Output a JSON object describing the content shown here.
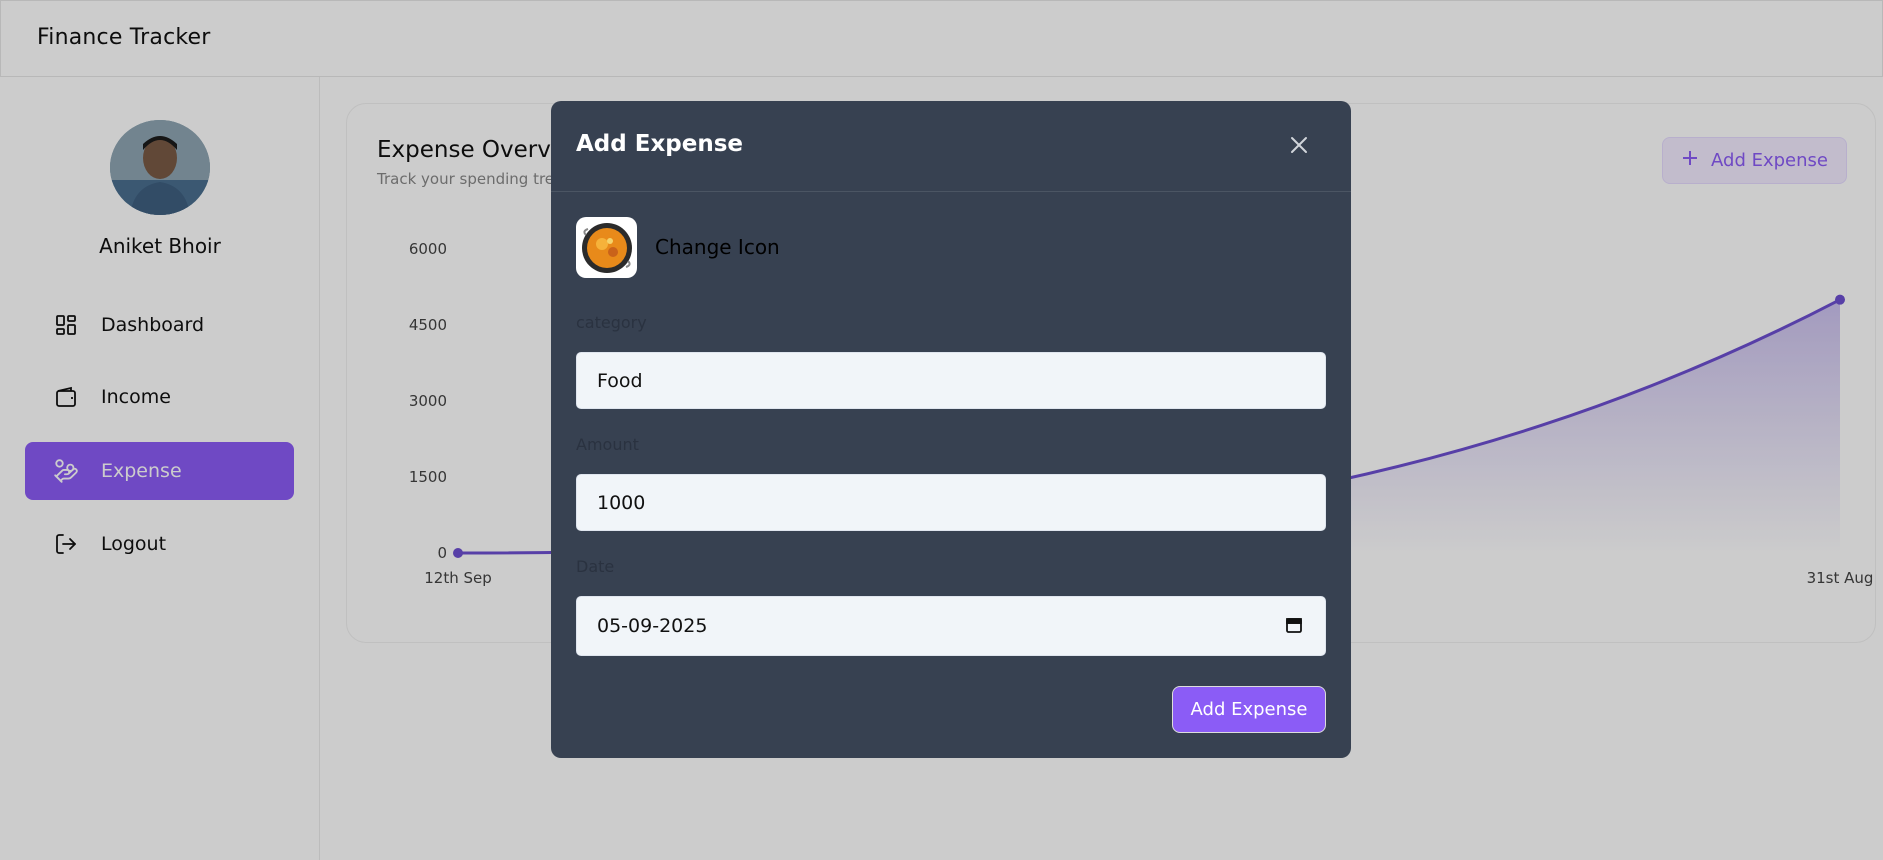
{
  "header": {
    "app_title": "Finance Tracker"
  },
  "sidebar": {
    "user_name": "Aniket Bhoir",
    "items": [
      {
        "label": "Dashboard",
        "icon": "dashboard-icon",
        "active": false
      },
      {
        "label": "Income",
        "icon": "wallet-icon",
        "active": false
      },
      {
        "label": "Expense",
        "icon": "hand-coins-icon",
        "active": true
      },
      {
        "label": "Logout",
        "icon": "logout-icon",
        "active": false
      }
    ]
  },
  "main": {
    "title": "Expense Overvie",
    "subtitle": "Track your spending tre",
    "add_button_label": "Add Expense"
  },
  "chart_data": {
    "type": "area",
    "x": [
      "12th Sep",
      "31st Aug"
    ],
    "y_ticks": [
      0,
      1500,
      3000,
      4500,
      6000
    ],
    "visible_points": [
      {
        "x": "12th Sep",
        "y": 0
      },
      {
        "x": "31st Aug",
        "y": 5000
      }
    ],
    "ylim": [
      0,
      6000
    ],
    "color": "#6d4fd1"
  },
  "modal": {
    "title": "Add Expense",
    "change_icon_label": "Change Icon",
    "category_label": "category",
    "category_value": "Food",
    "amount_label": "Amount",
    "amount_value": "1000",
    "date_label": "Date",
    "date_value": "05-09-2025",
    "submit_label": "Add Expense"
  },
  "colors": {
    "accent": "#8b5cf6",
    "modal_bg": "#374151",
    "input_bg": "#f1f5f9"
  }
}
